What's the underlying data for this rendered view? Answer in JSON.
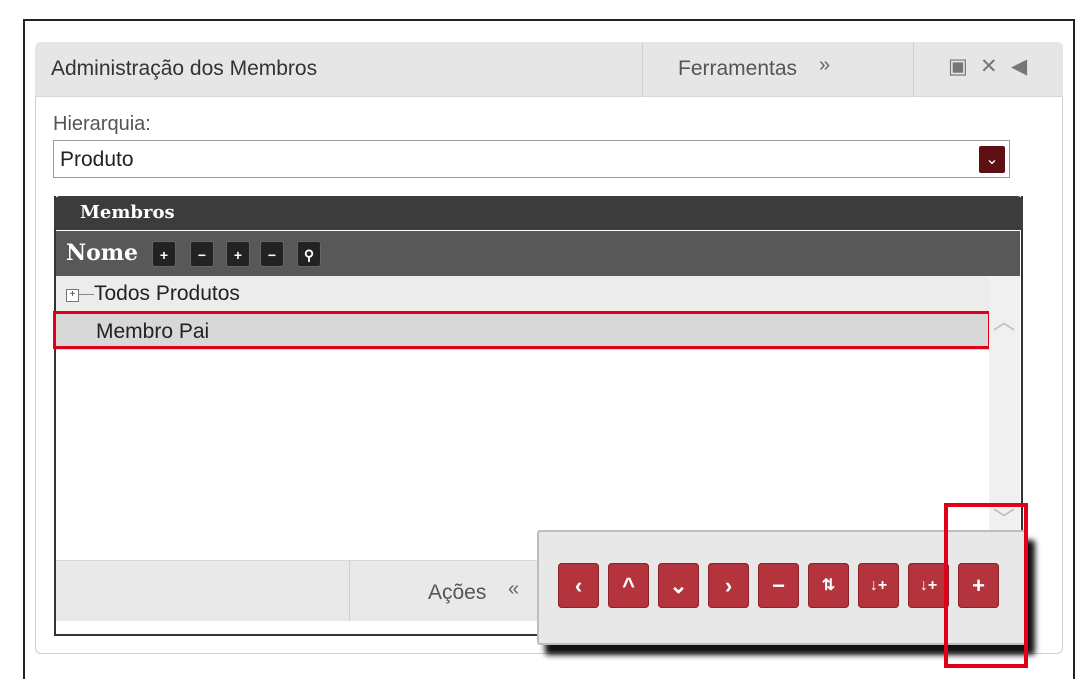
{
  "window": {
    "title": "Administração dos Membros",
    "tools_label": "Ferramentas",
    "icons": [
      "minimize-icon",
      "close-icon",
      "back-arrow-icon"
    ]
  },
  "hierarchy": {
    "label": "Hierarquia:",
    "selected": "Produto"
  },
  "members": {
    "panel_title": "Membros",
    "column_header": "Nome",
    "header_buttons": [
      "expand-all-icon",
      "collapse-all-icon",
      "add-node-icon",
      "remove-node-icon",
      "search-icon"
    ],
    "rows": [
      {
        "label": "Todos Produtos",
        "expandable": true
      },
      {
        "label": "Membro Pai",
        "selected": true
      }
    ]
  },
  "footer": {
    "actions_label": "Ações"
  },
  "action_toolbar": {
    "buttons": [
      {
        "name": "move-left",
        "glyph": "‹"
      },
      {
        "name": "move-up",
        "glyph": "^"
      },
      {
        "name": "move-down",
        "glyph": "⌄"
      },
      {
        "name": "move-right",
        "glyph": "›"
      },
      {
        "name": "remove",
        "glyph": "−"
      },
      {
        "name": "add-sibling",
        "glyph": "⇅"
      },
      {
        "name": "add-child-below",
        "glyph": "↓+"
      },
      {
        "name": "add-child-above",
        "glyph": "↓+"
      },
      {
        "name": "add",
        "glyph": "+"
      }
    ]
  },
  "colors": {
    "accent": "#b3343c",
    "dropdown_button": "#5e0f14",
    "highlight": "#e0001a",
    "header_dark": "#3c3c3c"
  }
}
